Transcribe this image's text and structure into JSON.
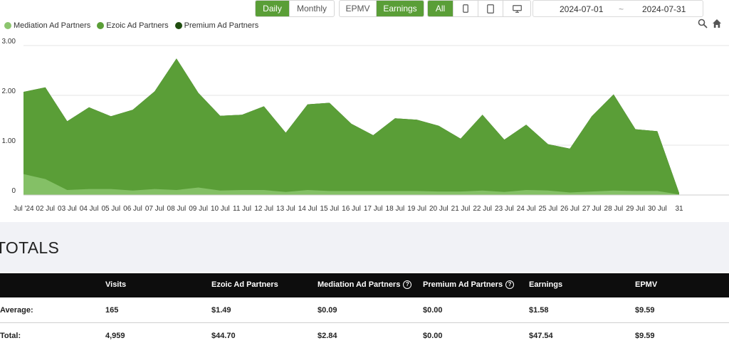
{
  "toolbar": {
    "period": [
      {
        "label": "Daily",
        "active": true
      },
      {
        "label": "Monthly",
        "active": false
      }
    ],
    "metric": [
      {
        "label": "EPMV",
        "active": false
      },
      {
        "label": "Earnings",
        "active": true
      }
    ],
    "device": [
      {
        "label": "All",
        "active": true
      },
      {
        "icon": "mobile-icon"
      },
      {
        "icon": "tablet-icon"
      },
      {
        "icon": "desktop-icon"
      }
    ],
    "date_from": "2024-07-01",
    "date_sep": "~",
    "date_to": "2024-07-31"
  },
  "colors": {
    "mediation": "#8cc56e",
    "ezoic": "#5a9e37",
    "premium": "#1f4d0f",
    "accent": "#5a9e37"
  },
  "chart_data": {
    "type": "area",
    "stacked": true,
    "x": [
      "Jul '24",
      "02 Jul",
      "03 Jul",
      "04 Jul",
      "05 Jul",
      "06 Jul",
      "07 Jul",
      "08 Jul",
      "09 Jul",
      "10 Jul",
      "11 Jul",
      "12 Jul",
      "13 Jul",
      "14 Jul",
      "15 Jul",
      "16 Jul",
      "17 Jul",
      "18 Jul",
      "19 Jul",
      "20 Jul",
      "21 Jul",
      "22 Jul",
      "23 Jul",
      "24 Jul",
      "25 Jul",
      "26 Jul",
      "27 Jul",
      "28 Jul",
      "29 Jul",
      "30 Jul",
      "31"
    ],
    "series": [
      {
        "name": "Mediation Ad Partners",
        "values": [
          0.42,
          0.32,
          0.1,
          0.12,
          0.12,
          0.09,
          0.12,
          0.1,
          0.15,
          0.09,
          0.1,
          0.1,
          0.06,
          0.1,
          0.08,
          0.08,
          0.08,
          0.08,
          0.08,
          0.07,
          0.07,
          0.09,
          0.06,
          0.1,
          0.09,
          0.05,
          0.07,
          0.09,
          0.08,
          0.08,
          0.01
        ]
      },
      {
        "name": "Ezoic Ad Partners",
        "values": [
          1.65,
          1.84,
          1.38,
          1.64,
          1.46,
          1.62,
          1.96,
          2.64,
          1.9,
          1.5,
          1.51,
          1.68,
          1.19,
          1.72,
          1.77,
          1.35,
          1.12,
          1.46,
          1.43,
          1.32,
          1.06,
          1.52,
          1.05,
          1.31,
          0.93,
          0.88,
          1.51,
          1.93,
          1.24,
          1.2,
          0.03
        ]
      },
      {
        "name": "Premium Ad Partners",
        "values": [
          0,
          0,
          0,
          0,
          0,
          0,
          0,
          0,
          0,
          0,
          0,
          0,
          0,
          0,
          0,
          0,
          0,
          0,
          0,
          0,
          0,
          0,
          0,
          0,
          0,
          0,
          0,
          0,
          0,
          0,
          0
        ]
      }
    ],
    "y_ticks": [
      "0",
      "1.00",
      "2.00",
      "3.00"
    ],
    "ylim": [
      0,
      3
    ],
    "grid": true,
    "legend": "top-left"
  },
  "totals": {
    "title": "TOTALS",
    "columns": [
      "Visits",
      "Ezoic Ad Partners",
      "Mediation Ad Partners",
      "Premium Ad Partners",
      "Earnings",
      "EPMV"
    ],
    "rows": [
      {
        "label": "Average:",
        "values": [
          "165",
          "$1.49",
          "$0.09",
          "$0.00",
          "$1.58",
          "$9.59"
        ]
      },
      {
        "label": "Total:",
        "values": [
          "4,959",
          "$44.70",
          "$2.84",
          "$0.00",
          "$47.54",
          "$9.59"
        ]
      }
    ]
  }
}
